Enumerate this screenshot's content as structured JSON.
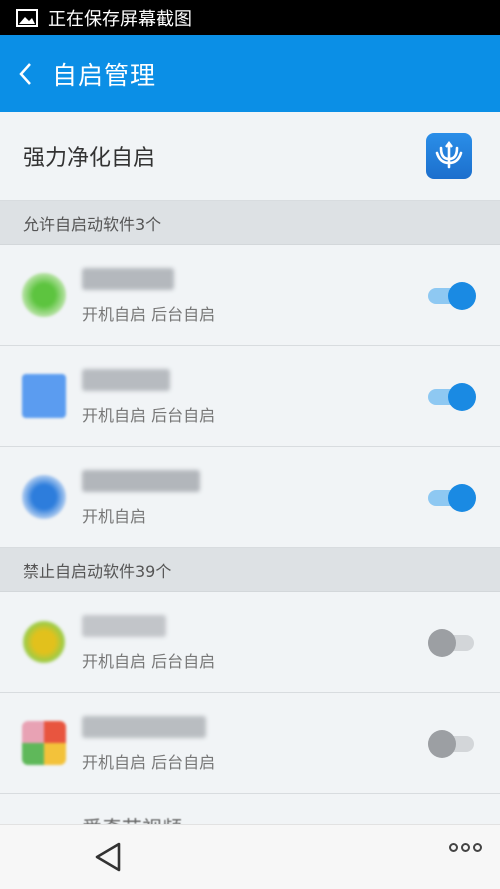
{
  "status_bar": {
    "text": "正在保存屏幕截图"
  },
  "app_bar": {
    "title": "自启管理"
  },
  "purify": {
    "label": "强力净化自启"
  },
  "allowed_section": {
    "title": "允许自启动软件3个"
  },
  "blocked_section": {
    "title": "禁止自启动软件39个"
  },
  "allowed_apps": [
    {
      "tags": "开机自启 后台自启",
      "enabled": true
    },
    {
      "tags": "开机自启 后台自启",
      "enabled": true
    },
    {
      "tags": "开机自启",
      "enabled": true
    }
  ],
  "blocked_apps": [
    {
      "tags": "开机自启 后台自启",
      "enabled": false
    },
    {
      "tags": "开机自启 后台自启",
      "enabled": false
    }
  ],
  "peek_row": {
    "text": "爱奇艺视频"
  },
  "colors": {
    "app_bar": "#0b8fe6",
    "toggle_on": "#1a8ae3",
    "toggle_off": "#9c9fa3"
  }
}
